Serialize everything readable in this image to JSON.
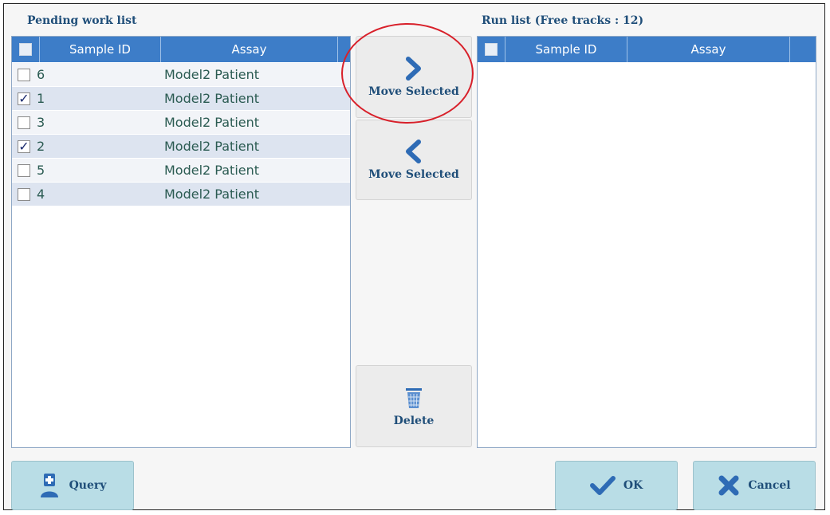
{
  "pending": {
    "title": "Pending work list",
    "columns": [
      "Sample ID",
      "Assay"
    ],
    "rows": [
      {
        "id": "6",
        "assay": "Model2 Patient",
        "checked": false
      },
      {
        "id": "1",
        "assay": "Model2 Patient",
        "checked": true
      },
      {
        "id": "3",
        "assay": "Model2 Patient",
        "checked": false
      },
      {
        "id": "2",
        "assay": "Model2 Patient",
        "checked": true
      },
      {
        "id": "5",
        "assay": "Model2 Patient",
        "checked": false
      },
      {
        "id": "4",
        "assay": "Model2 Patient",
        "checked": false
      }
    ]
  },
  "runlist": {
    "title": "Run list (Free tracks : 12)",
    "columns": [
      "Sample ID",
      "Assay"
    ]
  },
  "middle": {
    "move_right_label": "Move Selected",
    "move_left_label": "Move Selected",
    "delete_label": "Delete"
  },
  "footer": {
    "query_label": "Query",
    "ok_label": "OK",
    "cancel_label": "Cancel"
  },
  "colors": {
    "header_blue": "#3d7dc8",
    "button_teal": "#b9dde6",
    "highlight_red": "#d8202a"
  }
}
